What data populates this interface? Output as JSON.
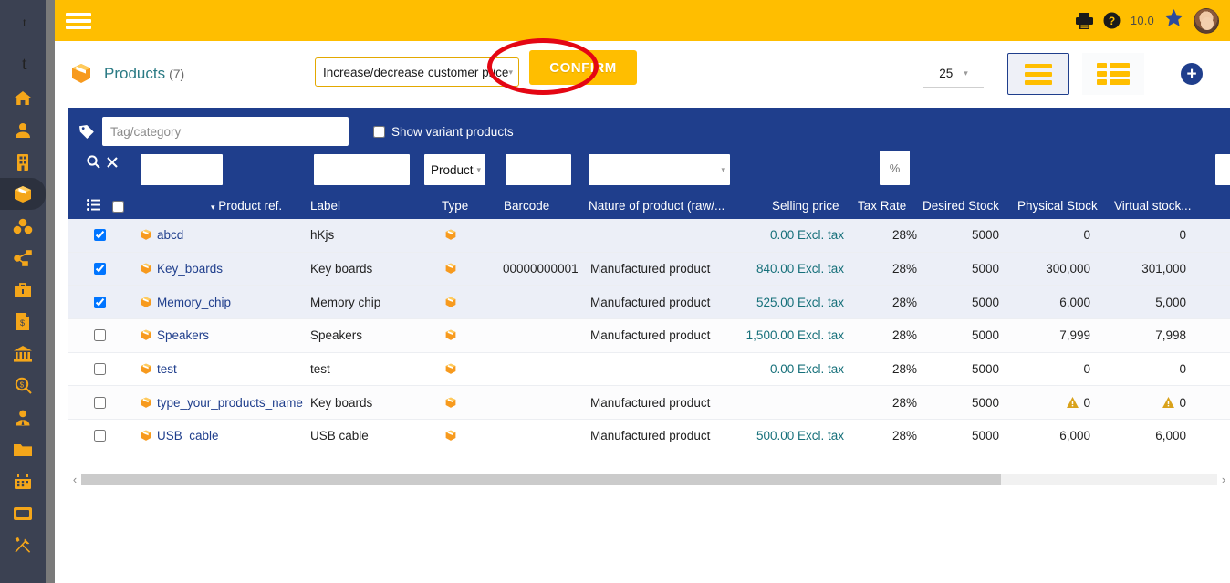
{
  "sidebar": {
    "logo_alt": "ct-logo",
    "items": [
      {
        "name": "home",
        "icon": "home-icon"
      },
      {
        "name": "third-parties",
        "icon": "user-icon"
      },
      {
        "name": "companies",
        "icon": "building-icon"
      },
      {
        "name": "products",
        "icon": "box-icon",
        "active": true
      },
      {
        "name": "stock",
        "icon": "stock-boxes-icon"
      },
      {
        "name": "bom",
        "icon": "share-nodes-icon"
      },
      {
        "name": "commercial",
        "icon": "briefcase-icon"
      },
      {
        "name": "billing",
        "icon": "invoice-icon"
      },
      {
        "name": "bank",
        "icon": "bank-icon"
      },
      {
        "name": "accounting",
        "icon": "money-search-icon"
      },
      {
        "name": "hrm",
        "icon": "user-tie-icon"
      },
      {
        "name": "documents",
        "icon": "folder-icon"
      },
      {
        "name": "agenda",
        "icon": "calendar-icon"
      },
      {
        "name": "pos",
        "icon": "card-icon"
      },
      {
        "name": "tools",
        "icon": "tools-icon"
      }
    ]
  },
  "topbar": {
    "menu_icon": "hamburger-icon",
    "print_icon": "printer-icon",
    "help_icon": "question-circle-icon",
    "version": "10.0",
    "star_icon": "star-icon",
    "avatar_icon": "user-avatar"
  },
  "page_header": {
    "icon": "box-icon",
    "title": "Products",
    "count": "(7)",
    "mass_action": {
      "value": "Increase/decrease customer price",
      "caret": "▾"
    },
    "confirm_label": "CONFIRM",
    "annotation": "red-ellipse-highlight",
    "page_size": "25",
    "view_list_icon": "list-view-icon",
    "view_grid_icon": "grid-view-icon",
    "add_icon": "plus-icon"
  },
  "filters": {
    "tag_icon": "tag-icon",
    "tag_placeholder": "Tag/category",
    "tag_value": "",
    "variant_label": "Show variant products",
    "variant_checked": false,
    "search_icon": "search-icon",
    "clear_icon": "clear-x-icon",
    "ref_filter": "",
    "label_filter": "",
    "type_filter": "Product",
    "type_caret": "▾",
    "barcode_filter": "",
    "nature_filter": "",
    "nature_caret": "▾",
    "tax_filter_placeholder": "%",
    "edge_filter": ""
  },
  "table": {
    "row_icon": "list-rows-icon",
    "select_all_checked": false,
    "sort_caret": "▾",
    "columns": [
      "Product ref.",
      "Label",
      "Type",
      "Barcode",
      "Nature of product (raw/...",
      "Selling price",
      "Tax Rate",
      "Desired Stock",
      "Physical Stock",
      "Virtual stock..."
    ],
    "rows": [
      {
        "selected": true,
        "ref": "abcd",
        "label": "hKjs",
        "type_icon": "box-icon",
        "barcode": "",
        "nature": "",
        "price": "0.00 Excl. tax",
        "tax": "28%",
        "desired": "5000",
        "physical": "0",
        "virtual": "0",
        "physical_warn": false,
        "virtual_warn": false
      },
      {
        "selected": true,
        "ref": "Key_boards",
        "label": "Key boards",
        "type_icon": "box-icon",
        "barcode": "00000000001",
        "nature": "Manufactured product",
        "price": "840.00 Excl. tax",
        "tax": "28%",
        "desired": "5000",
        "physical": "300,000",
        "virtual": "301,000",
        "physical_warn": false,
        "virtual_warn": false
      },
      {
        "selected": true,
        "ref": "Memory_chip",
        "label": "Memory chip",
        "type_icon": "box-icon",
        "barcode": "",
        "nature": "Manufactured product",
        "price": "525.00 Excl. tax",
        "tax": "28%",
        "desired": "5000",
        "physical": "6,000",
        "virtual": "5,000",
        "physical_warn": false,
        "virtual_warn": false
      },
      {
        "selected": false,
        "ref": "Speakers",
        "label": "Speakers",
        "type_icon": "box-icon",
        "barcode": "",
        "nature": "Manufactured product",
        "price": "1,500.00 Excl. tax",
        "tax": "28%",
        "desired": "5000",
        "physical": "7,999",
        "virtual": "7,998",
        "physical_warn": false,
        "virtual_warn": false
      },
      {
        "selected": false,
        "ref": "test",
        "label": "test",
        "type_icon": "box-icon",
        "barcode": "",
        "nature": "",
        "price": "0.00 Excl. tax",
        "tax": "28%",
        "desired": "5000",
        "physical": "0",
        "virtual": "0",
        "physical_warn": false,
        "virtual_warn": false
      },
      {
        "selected": false,
        "ref": "type_your_products_name",
        "label": "Key boards",
        "type_icon": "box-icon",
        "barcode": "",
        "nature": "Manufactured product",
        "price": "",
        "tax": "28%",
        "desired": "5000",
        "physical": "0",
        "virtual": "0",
        "physical_warn": true,
        "virtual_warn": true
      },
      {
        "selected": false,
        "ref": "USB_cable",
        "label": "USB cable",
        "type_icon": "box-icon",
        "barcode": "",
        "nature": "Manufactured product",
        "price": "500.00 Excl. tax",
        "tax": "28%",
        "desired": "5000",
        "physical": "6,000",
        "virtual": "6,000",
        "physical_warn": false,
        "virtual_warn": false
      }
    ]
  },
  "scrollbar": {
    "left_arrow": "‹",
    "right_arrow": "›",
    "thumb_percent": "81"
  },
  "colors": {
    "brand_yellow": "#ffbe00",
    "panel_blue": "#1f3e8c",
    "sidebar_dark": "#3b4152",
    "accent_orange": "#f79a1e",
    "price_teal": "#16707a",
    "annotation_red": "#e40613"
  }
}
